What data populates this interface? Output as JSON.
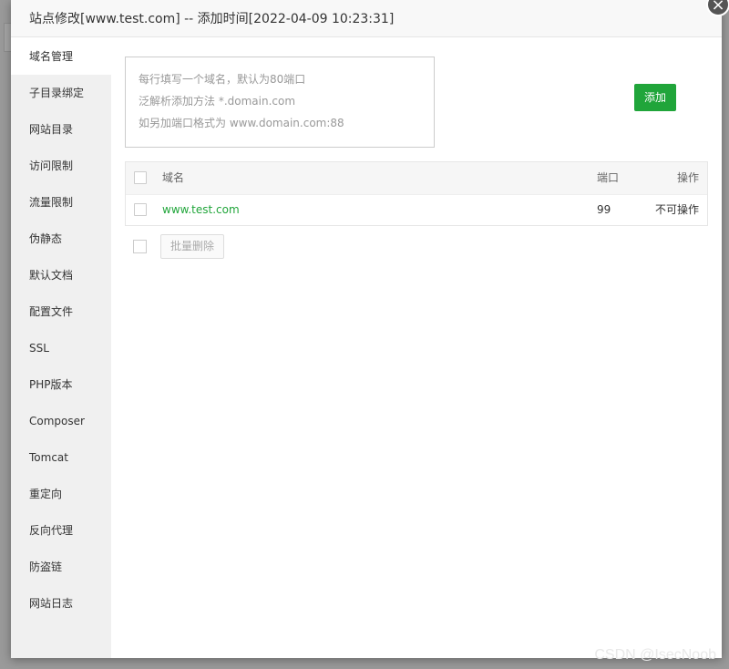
{
  "dialog": {
    "title": "站点修改[www.test.com] -- 添加时间[2022-04-09 10:23:31]",
    "close_icon": "×"
  },
  "sidebar": {
    "items": [
      {
        "label": "域名管理",
        "active": true
      },
      {
        "label": "子目录绑定"
      },
      {
        "label": "网站目录"
      },
      {
        "label": "访问限制"
      },
      {
        "label": "流量限制"
      },
      {
        "label": "伪静态"
      },
      {
        "label": "默认文档"
      },
      {
        "label": "配置文件"
      },
      {
        "label": "SSL"
      },
      {
        "label": "PHP版本"
      },
      {
        "label": "Composer"
      },
      {
        "label": "Tomcat"
      },
      {
        "label": "重定向"
      },
      {
        "label": "反向代理"
      },
      {
        "label": "防盗链"
      },
      {
        "label": "网站日志"
      }
    ]
  },
  "domain_input": {
    "placeholder_lines": [
      "每行填写一个域名，默认为80端口",
      "泛解析添加方法 *.domain.com",
      "如另加端口格式为 www.domain.com:88"
    ]
  },
  "add_button": {
    "label": "添加",
    "color": "#20a53a"
  },
  "table": {
    "headers": {
      "domain": "域名",
      "port": "端口",
      "action": "操作"
    },
    "rows": [
      {
        "domain": "www.test.com",
        "port": "99",
        "action": "不可操作"
      }
    ]
  },
  "batch_delete": {
    "label": "批量删除"
  },
  "watermark": "CSDN @IsecNoob"
}
